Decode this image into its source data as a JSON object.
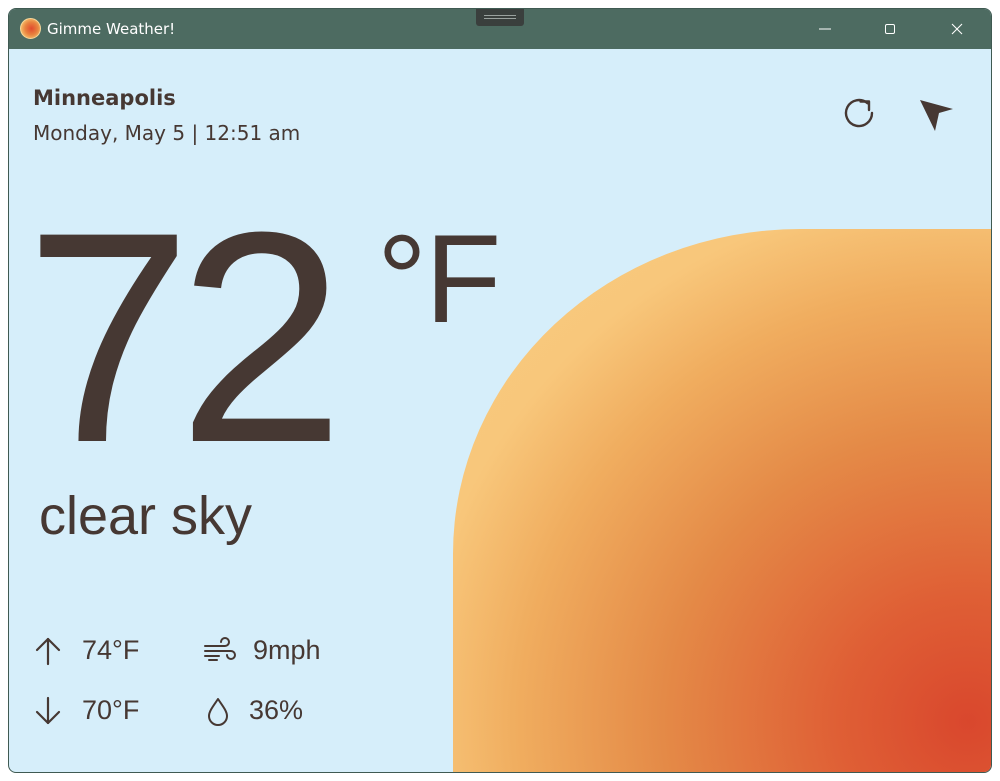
{
  "window": {
    "title": "Gimme Weather!",
    "controls": [
      "minimize",
      "maximize",
      "close"
    ]
  },
  "location": {
    "city": "Minneapolis",
    "datetime": "Monday, May 5 | 12:51 am"
  },
  "actions": {
    "refresh_icon": "refresh-icon",
    "locate_icon": "navigation-arrow-icon"
  },
  "current": {
    "temperature": "72",
    "unit": "°F",
    "condition": "clear sky"
  },
  "stats": {
    "high": "74°F",
    "low": "70°F",
    "wind": "9mph",
    "humidity": "36%"
  },
  "colors": {
    "titlebar": "#4d6b61",
    "background": "#d6eefa",
    "text": "#463833",
    "sun_outer": "#f8ca7e",
    "sun_inner": "#d9472d"
  }
}
